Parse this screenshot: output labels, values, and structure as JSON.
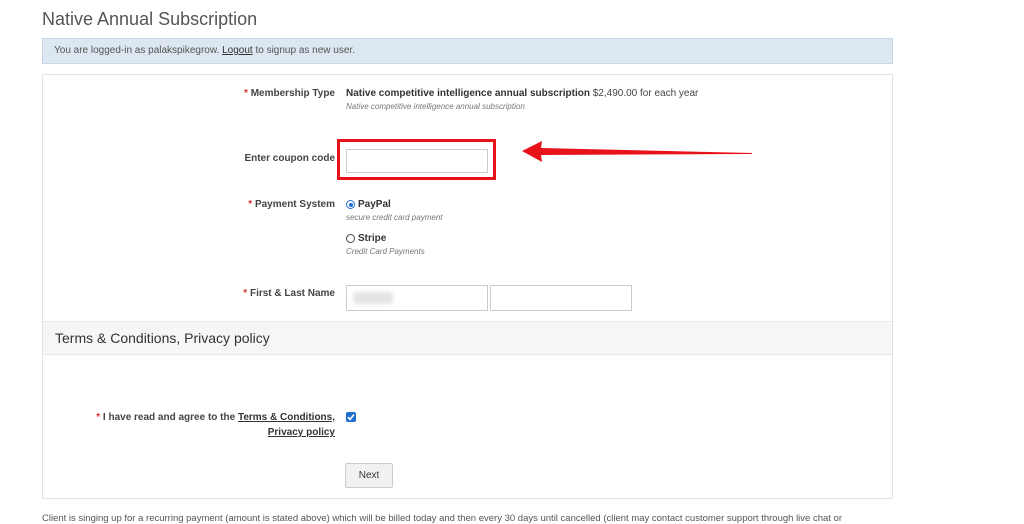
{
  "page": {
    "title": "Native Annual Subscription"
  },
  "notice": {
    "prefix": "You are logged-in as palakspikegrow.",
    "logout_link": "Logout",
    "suffix": "to signup as new user."
  },
  "membership": {
    "label": "Membership Type",
    "name": "Native competitive intelligence annual subscription",
    "price": "$2,490.00 for each year",
    "description": "Native competitive intelligence annual subscription"
  },
  "coupon": {
    "label": "Enter coupon code",
    "value": ""
  },
  "payment": {
    "label": "Payment System",
    "options": [
      {
        "name": "PayPal",
        "description": "secure credit card payment",
        "selected": true
      },
      {
        "name": "Stripe",
        "description": "Credit Card Payments",
        "selected": false
      }
    ]
  },
  "name_fields": {
    "label": "First & Last Name",
    "first_value": "",
    "last_value": ""
  },
  "terms": {
    "heading": "Terms & Conditions, Privacy policy",
    "agree_prefix": "I have read and agree to the",
    "link1": "Terms & Conditions,",
    "link2": "Privacy policy",
    "checked": true
  },
  "buttons": {
    "next": "Next"
  },
  "footer": {
    "note": "Client is singing up for a recurring payment (amount is stated above) which will be billed today and then every 30 days until cancelled (client may contact customer support through live chat or"
  },
  "required_mark": "*",
  "colors": {
    "highlight": "#e8121b",
    "accent": "#1f6fd1",
    "notice_bg": "#dde7f1"
  }
}
